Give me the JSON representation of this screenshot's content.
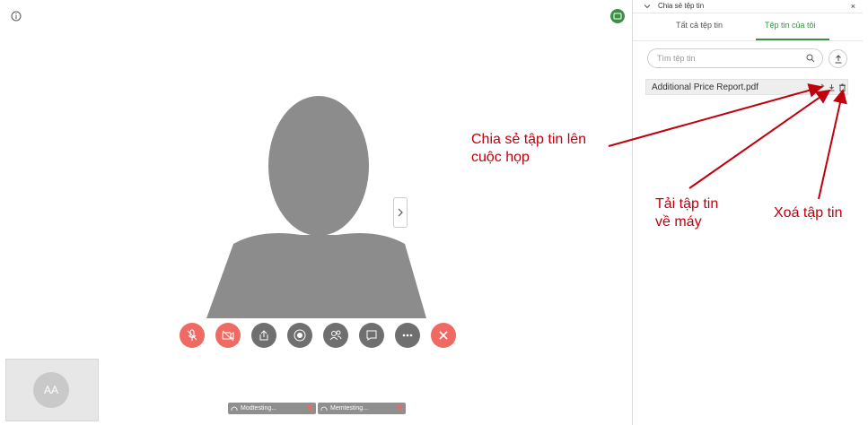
{
  "panel": {
    "title": "Chia sẻ tệp tin",
    "close": "×",
    "tabs": [
      {
        "label": "Tất cả tệp tin",
        "active": false
      },
      {
        "label": "Tệp tin của tôi",
        "active": true
      }
    ],
    "search_placeholder": "Tìm tệp tin",
    "files": [
      {
        "name": "Additional Price Report.pdf"
      }
    ]
  },
  "self_view": {
    "initials": "AA"
  },
  "participants": [
    {
      "name": "Modtesting..."
    },
    {
      "name": "Memtesting..."
    }
  ],
  "annotations": {
    "share": [
      "Chia sẻ tập tin lên",
      "cuộc họp"
    ],
    "download": [
      "Tải tập tin",
      "về máy"
    ],
    "delete": [
      "Xoá tập tin"
    ]
  },
  "colors": {
    "accent": "#3c8f45",
    "danger": "#ef6a62",
    "control": "#6f6f6f",
    "annotation": "#c0000c"
  },
  "icons": [
    "info-icon",
    "chat-icon",
    "chevron-right-icon",
    "mic-off-icon",
    "camera-off-icon",
    "share-screen-icon",
    "record-icon",
    "participants-icon",
    "chat-bubble-icon",
    "more-icon",
    "end-call-icon",
    "upload-icon",
    "search-icon",
    "share-file-icon",
    "download-icon",
    "trash-icon",
    "headset-icon"
  ]
}
